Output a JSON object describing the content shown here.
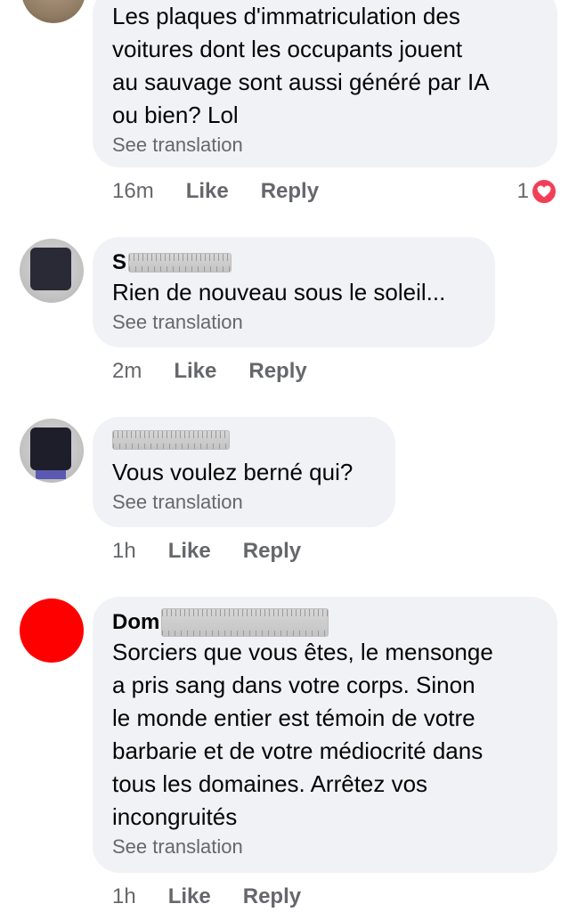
{
  "comments": [
    {
      "text": "Les plaques d'immatriculation des\nvoitures dont les occupants jouent\nau sauvage sont aussi généré par IA\nou bien? Lol",
      "see_translation": "See translation",
      "time": "16m",
      "like": "Like",
      "reply": "Reply",
      "reaction_count": "1",
      "reaction_icon": "heart-icon",
      "reaction_color": "#f33e58"
    },
    {
      "author_visible": "S",
      "text": "Rien de nouveau sous le soleil...",
      "see_translation": "See translation",
      "time": "2m",
      "like": "Like",
      "reply": "Reply"
    },
    {
      "text": "Vous voulez berné qui?",
      "see_translation": "See translation",
      "time": "1h",
      "like": "Like",
      "reply": "Reply"
    },
    {
      "author_visible": "Dom",
      "text": "Sorciers que vous êtes, le mensonge\na pris sang dans votre corps. Sinon\nle monde entier est témoin de votre\nbarbarie et de votre médiocrité dans\ntous les domaines. Arrêtez vos\nincongruités",
      "see_translation": "See translation",
      "time": "1h",
      "like": "Like",
      "reply": "Reply",
      "avatar_color": "#ff0000"
    }
  ],
  "colors": {
    "bubble": "#f0f2f5",
    "meta_text": "#65676b",
    "body_text": "#050505"
  }
}
